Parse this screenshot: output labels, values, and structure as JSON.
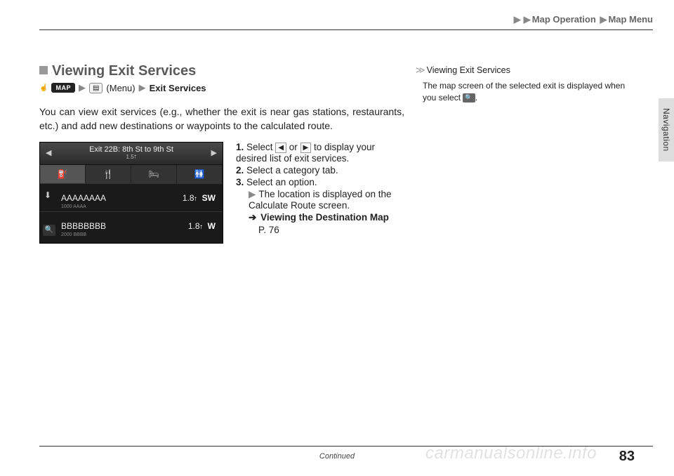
{
  "breadcrumb": {
    "a": "Map Operation",
    "b": "Map Menu"
  },
  "side_tab": "Navigation",
  "section": {
    "heading": "Viewing Exit Services",
    "path": {
      "map_btn": "MAP",
      "menu_label": "(Menu)",
      "dest": "Exit Services"
    },
    "body": "You can view exit services (e.g., whether the exit is near gas stations, restaurants, etc.) and add new destinations or waypoints to the calculated route."
  },
  "screenshot": {
    "title": "Exit 22B: 8th St to 9th St",
    "sub": "1.5",
    "rows": [
      {
        "name": "AAAAAAAA",
        "sub": "1000 AAAA",
        "dist": "1.8",
        "dir": "SW"
      },
      {
        "name": "BBBBBBBB",
        "sub": "2000 BBBB",
        "dist": "1.8",
        "dir": "W"
      }
    ]
  },
  "steps": {
    "s1a": "Select ",
    "s1b": " or ",
    "s1c": " to display your desired list of exit services.",
    "s2": "Select a category tab.",
    "s3": "Select an option.",
    "s3sub": "The location is displayed on the Calculate Route screen.",
    "link_label": "Viewing the Destination Map",
    "link_page": "P. 76"
  },
  "sidenote": {
    "title": "Viewing Exit Services",
    "body_a": "The map screen of the selected exit is displayed when you select ",
    "body_b": "."
  },
  "footer": {
    "continued": "Continued",
    "page": "83"
  },
  "watermark": "carmanualsonline.info"
}
